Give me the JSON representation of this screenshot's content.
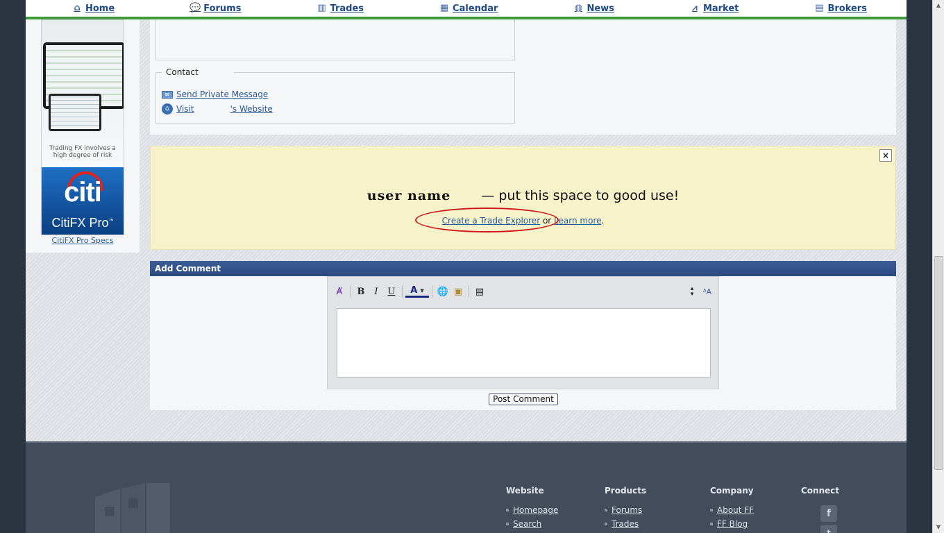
{
  "nav": {
    "items": [
      {
        "label": "Home",
        "icon": "home-icon"
      },
      {
        "label": "Forums",
        "icon": "forums-icon"
      },
      {
        "label": "Trades",
        "icon": "trades-icon"
      },
      {
        "label": "Calendar",
        "icon": "calendar-icon"
      },
      {
        "label": "News",
        "icon": "news-icon"
      },
      {
        "label": "Market",
        "icon": "market-icon"
      },
      {
        "label": "Brokers",
        "icon": "brokers-icon"
      }
    ]
  },
  "sidebar_ad": {
    "risk_text": "Trading FX involves a high degree of risk",
    "brand_word": "citi",
    "brand_sub": "CitiFX Pro",
    "trademark": "™",
    "link_label": "CitiFX Pro Specs"
  },
  "contact": {
    "legend": "Contact",
    "send_message": "Send Private Message",
    "visit_prefix": "Visit",
    "visit_suffix": "'s Website"
  },
  "promo": {
    "username": "user name",
    "headline_tail": "— put this space to good use!",
    "create_link": "Create a Trade Explorer",
    "or_text": "or",
    "learn_link": "Learn more",
    "period": ".",
    "close_label": "×"
  },
  "comment": {
    "header": "Add Comment",
    "post_button": "Post Comment"
  },
  "footer": {
    "columns": [
      {
        "title": "Website",
        "links": [
          "Homepage",
          "Search"
        ]
      },
      {
        "title": "Products",
        "links": [
          "Forums",
          "Trades"
        ]
      },
      {
        "title": "Company",
        "links": [
          "About FF",
          "FF Blog"
        ]
      }
    ],
    "connect_title": "Connect"
  },
  "colors": {
    "nav_green": "#3f9a3a",
    "link_blue": "#2a5a9a",
    "header_blue": "#2a4a80",
    "promo_bg": "#f6f3cb",
    "highlight_red": "#d01818",
    "footer_bg": "#434c5b"
  }
}
